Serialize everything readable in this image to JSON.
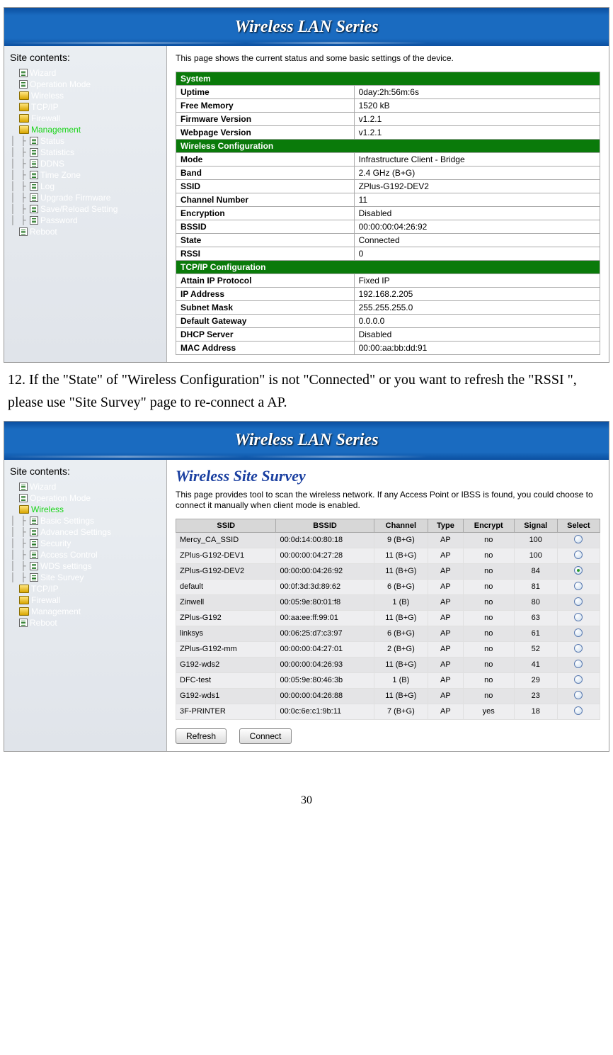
{
  "banner_title": "Wireless LAN Series",
  "instruction_text": "12. If the \"State\" of \"Wireless Configuration\" is not \"Connected\" or you want to refresh the \"RSSI \", please use \"Site Survey\" page to re-connect a AP.",
  "page_number": "30",
  "panel1": {
    "sidebar_heading": "Site contents:",
    "tree": [
      {
        "indent": 0,
        "icon": "page",
        "label": "Wizard",
        "active": false
      },
      {
        "indent": 0,
        "icon": "page",
        "label": "Operation Mode",
        "active": false
      },
      {
        "indent": 0,
        "icon": "folder",
        "label": "Wireless",
        "active": false
      },
      {
        "indent": 0,
        "icon": "folder",
        "label": "TCP/IP",
        "active": false
      },
      {
        "indent": 0,
        "icon": "folder",
        "label": "Firewall",
        "active": false
      },
      {
        "indent": 0,
        "icon": "folder",
        "label": "Management",
        "active": true
      },
      {
        "indent": 1,
        "icon": "page",
        "label": "Status",
        "active": false
      },
      {
        "indent": 1,
        "icon": "page",
        "label": "Statistics",
        "active": false
      },
      {
        "indent": 1,
        "icon": "page",
        "label": "DDNS",
        "active": false
      },
      {
        "indent": 1,
        "icon": "page",
        "label": "Time Zone",
        "active": false
      },
      {
        "indent": 1,
        "icon": "page",
        "label": "Log",
        "active": false
      },
      {
        "indent": 1,
        "icon": "page",
        "label": "Upgrade Firmware",
        "active": false
      },
      {
        "indent": 1,
        "icon": "page",
        "label": "Save/Reload Setting",
        "active": false
      },
      {
        "indent": 1,
        "icon": "page",
        "label": "Password",
        "active": false
      },
      {
        "indent": 0,
        "icon": "page",
        "label": "Reboot",
        "active": false
      }
    ],
    "desc": "This page shows the current status and some basic settings of the device.",
    "sections": [
      {
        "header": "System",
        "rows": [
          {
            "label": "Uptime",
            "value": "0day:2h:56m:6s"
          },
          {
            "label": "Free Memory",
            "value": "1520 kB"
          },
          {
            "label": "Firmware Version",
            "value": "v1.2.1"
          },
          {
            "label": "Webpage Version",
            "value": "v1.2.1"
          }
        ]
      },
      {
        "header": "Wireless Configuration",
        "rows": [
          {
            "label": "Mode",
            "value": "Infrastructure Client - Bridge"
          },
          {
            "label": "Band",
            "value": "2.4 GHz (B+G)"
          },
          {
            "label": "SSID",
            "value": "ZPlus-G192-DEV2"
          },
          {
            "label": "Channel Number",
            "value": "11"
          },
          {
            "label": "Encryption",
            "value": "Disabled"
          },
          {
            "label": "BSSID",
            "value": "00:00:00:04:26:92"
          },
          {
            "label": "State",
            "value": "Connected"
          },
          {
            "label": "RSSI",
            "value": "0"
          }
        ]
      },
      {
        "header": "TCP/IP Configuration",
        "rows": [
          {
            "label": "Attain IP Protocol",
            "value": "Fixed IP"
          },
          {
            "label": "IP Address",
            "value": "192.168.2.205"
          },
          {
            "label": "Subnet Mask",
            "value": "255.255.255.0"
          },
          {
            "label": "Default Gateway",
            "value": "0.0.0.0"
          },
          {
            "label": "DHCP Server",
            "value": "Disabled"
          },
          {
            "label": "MAC Address",
            "value": "00:00:aa:bb:dd:91"
          }
        ]
      }
    ]
  },
  "panel2": {
    "sidebar_heading": "Site contents:",
    "tree": [
      {
        "indent": 0,
        "icon": "page",
        "label": "Wizard",
        "active": false
      },
      {
        "indent": 0,
        "icon": "page",
        "label": "Operation Mode",
        "active": false
      },
      {
        "indent": 0,
        "icon": "folder",
        "label": "Wireless",
        "active": true
      },
      {
        "indent": 1,
        "icon": "page",
        "label": "Basic Settings",
        "active": false
      },
      {
        "indent": 1,
        "icon": "page",
        "label": "Advanced Settings",
        "active": false
      },
      {
        "indent": 1,
        "icon": "page",
        "label": "Security",
        "active": false
      },
      {
        "indent": 1,
        "icon": "page",
        "label": "Access Control",
        "active": false
      },
      {
        "indent": 1,
        "icon": "page",
        "label": "WDS settings",
        "active": false
      },
      {
        "indent": 1,
        "icon": "page",
        "label": "Site Survey",
        "active": false
      },
      {
        "indent": 0,
        "icon": "folder",
        "label": "TCP/IP",
        "active": false
      },
      {
        "indent": 0,
        "icon": "folder",
        "label": "Firewall",
        "active": false
      },
      {
        "indent": 0,
        "icon": "folder",
        "label": "Management",
        "active": false
      },
      {
        "indent": 0,
        "icon": "page",
        "label": "Reboot",
        "active": false
      }
    ],
    "title": "Wireless Site Survey",
    "desc": "This page provides tool to scan the wireless network. If any Access Point or IBSS is found, you could choose to connect it manually when client mode is enabled.",
    "table_headers": {
      "ssid": "SSID",
      "bssid": "BSSID",
      "channel": "Channel",
      "type": "Type",
      "encrypt": "Encrypt",
      "signal": "Signal",
      "select": "Select"
    },
    "rows": [
      {
        "ssid": "Mercy_CA_SSID",
        "bssid": "00:0d:14:00:80:18",
        "channel": "9 (B+G)",
        "type": "AP",
        "encrypt": "no",
        "signal": "100",
        "selected": false
      },
      {
        "ssid": "ZPlus-G192-DEV1",
        "bssid": "00:00:00:04:27:28",
        "channel": "11 (B+G)",
        "type": "AP",
        "encrypt": "no",
        "signal": "100",
        "selected": false
      },
      {
        "ssid": "ZPlus-G192-DEV2",
        "bssid": "00:00:00:04:26:92",
        "channel": "11 (B+G)",
        "type": "AP",
        "encrypt": "no",
        "signal": "84",
        "selected": true
      },
      {
        "ssid": "default",
        "bssid": "00:0f:3d:3d:89:62",
        "channel": "6 (B+G)",
        "type": "AP",
        "encrypt": "no",
        "signal": "81",
        "selected": false
      },
      {
        "ssid": "Zinwell",
        "bssid": "00:05:9e:80:01:f8",
        "channel": "1 (B)",
        "type": "AP",
        "encrypt": "no",
        "signal": "80",
        "selected": false
      },
      {
        "ssid": "ZPlus-G192",
        "bssid": "00:aa:ee:ff:99:01",
        "channel": "11 (B+G)",
        "type": "AP",
        "encrypt": "no",
        "signal": "63",
        "selected": false
      },
      {
        "ssid": "linksys",
        "bssid": "00:06:25:d7:c3:97",
        "channel": "6 (B+G)",
        "type": "AP",
        "encrypt": "no",
        "signal": "61",
        "selected": false
      },
      {
        "ssid": "ZPlus-G192-mm",
        "bssid": "00:00:00:04:27:01",
        "channel": "2 (B+G)",
        "type": "AP",
        "encrypt": "no",
        "signal": "52",
        "selected": false
      },
      {
        "ssid": "G192-wds2",
        "bssid": "00:00:00:04:26:93",
        "channel": "11 (B+G)",
        "type": "AP",
        "encrypt": "no",
        "signal": "41",
        "selected": false
      },
      {
        "ssid": "DFC-test",
        "bssid": "00:05:9e:80:46:3b",
        "channel": "1 (B)",
        "type": "AP",
        "encrypt": "no",
        "signal": "29",
        "selected": false
      },
      {
        "ssid": "G192-wds1",
        "bssid": "00:00:00:04:26:88",
        "channel": "11 (B+G)",
        "type": "AP",
        "encrypt": "no",
        "signal": "23",
        "selected": false
      },
      {
        "ssid": "3F-PRINTER",
        "bssid": "00:0c:6e:c1:9b:11",
        "channel": "7 (B+G)",
        "type": "AP",
        "encrypt": "yes",
        "signal": "18",
        "selected": false
      }
    ],
    "buttons": {
      "refresh": "Refresh",
      "connect": "Connect"
    }
  }
}
